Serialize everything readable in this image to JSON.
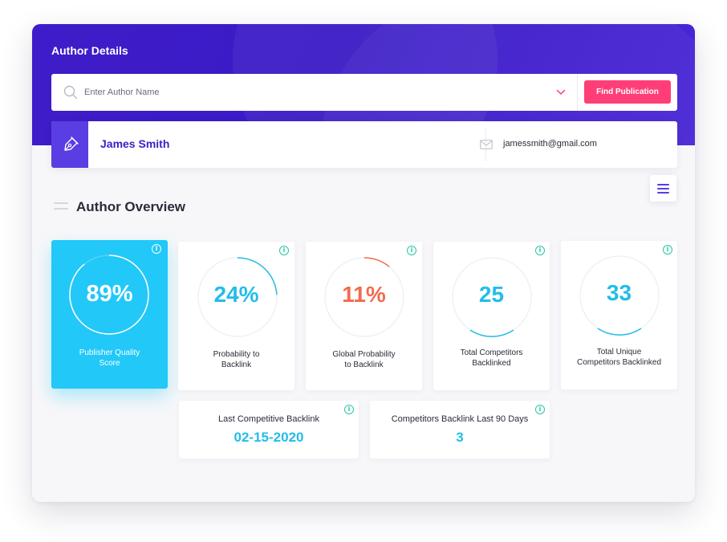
{
  "header": {
    "title": "Author Details"
  },
  "search": {
    "placeholder": "Enter Author Name",
    "button_label": "Find Publication"
  },
  "author": {
    "name": "James Smith",
    "email": "jamessmith@gmail.com"
  },
  "overview": {
    "title": "Author Overview",
    "metrics": [
      {
        "value": "89%",
        "fraction": 0.89,
        "label_line1": "Publisher Quality",
        "label_line2": "Score",
        "ring_color": "#ffffff",
        "value_color": "#ffffff"
      },
      {
        "value": "24%",
        "fraction": 0.24,
        "label_line1": "Probability to",
        "label_line2": "Backlink",
        "ring_color": "#23bde8",
        "value_color": "#23bde8"
      },
      {
        "value": "11%",
        "fraction": 0.11,
        "label_line1": "Global Probability",
        "label_line2": "to Backlink",
        "ring_color": "#f26b4f",
        "value_color": "#f26b4f"
      },
      {
        "value": "25",
        "label_line1": "Total Competitors",
        "label_line2": "Backlinked",
        "ring_color": "#23bde8",
        "value_color": "#23bde8"
      },
      {
        "value": "33",
        "label_line1": "Total Unique",
        "label_line2": "Competitors Backlinked",
        "ring_color": "#23bde8",
        "value_color": "#23bde8"
      }
    ],
    "wide_metrics": [
      {
        "title": "Last Competitive Backlink",
        "value": "02-15-2020"
      },
      {
        "title": "Competitors Backlink Last 90 Days",
        "value": "3"
      }
    ],
    "info_glyph": "i"
  },
  "colors": {
    "brand_purple": "#3f1cc9",
    "accent_pink": "#ff3e78",
    "accent_cyan": "#22c8f8",
    "accent_orange": "#f26b4f"
  },
  "icons": {
    "search": "search-icon",
    "dropdown": "chevron-down-icon",
    "author": "pen-nib-icon",
    "email": "mail-icon",
    "menu": "hamburger-menu-icon",
    "info": "info-icon"
  }
}
